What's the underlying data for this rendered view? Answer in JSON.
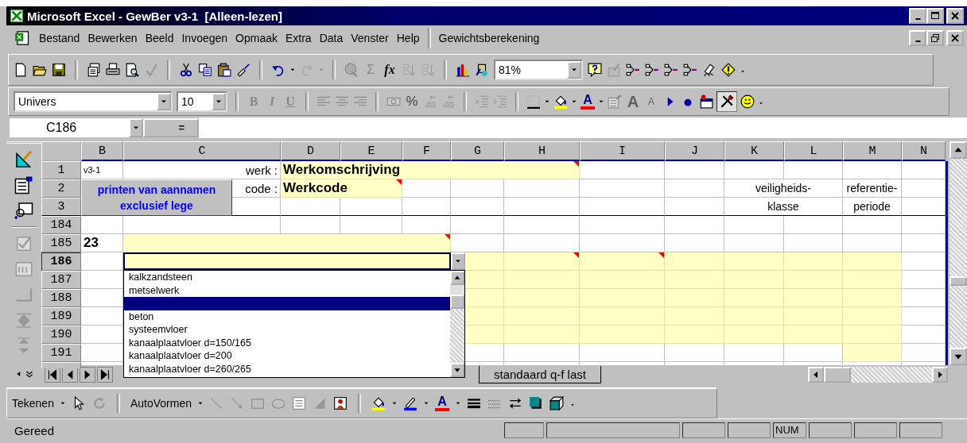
{
  "window": {
    "title": "Microsoft Excel - GewBer v3-1  [Alleen-lezen]"
  },
  "menu": {
    "items": [
      "Bestand",
      "Bewerken",
      "Beeld",
      "Invoegen",
      "Opmaak",
      "Extra",
      "Data",
      "Venster",
      "Help"
    ],
    "custom": "Gewichtsberekening"
  },
  "standard_toolbar": {
    "sum_symbol": "Σ",
    "function_symbol": "fx",
    "zoom": "81%"
  },
  "format_toolbar": {
    "font": "Univers",
    "size": "10",
    "bold": "B",
    "italic": "I",
    "underline": "U",
    "percent": "%",
    "font_color": "A",
    "grow_font": "A",
    "shrink_font": "A"
  },
  "formula_bar": {
    "name_box": "C186",
    "equals": "="
  },
  "sheet": {
    "columns": [
      "B",
      "C",
      "D",
      "E",
      "F",
      "G",
      "H",
      "I",
      "J",
      "K",
      "L",
      "M",
      "N"
    ],
    "button": "printen van aannamen exclusief lege",
    "rows": [
      {
        "number": "1",
        "active": false,
        "rule_below": false,
        "cells": [
          {
            "kind": "note",
            "text": "v3-1"
          },
          {
            "kind": "label",
            "text": "werk :"
          },
          {
            "kind": "value",
            "text": "Werkomschrijving",
            "comment": true
          },
          {
            "kind": "merged"
          },
          {
            "kind": "merged"
          },
          {
            "kind": "merged"
          },
          {
            "kind": "merged"
          },
          {
            "kind": "empty"
          },
          {
            "kind": "empty"
          },
          {
            "kind": "empty"
          },
          {
            "kind": "empty"
          },
          {
            "kind": "empty"
          },
          {
            "kind": "empty"
          }
        ]
      },
      {
        "number": "2",
        "active": false,
        "rule_below": false,
        "cells": [
          {
            "kind": "covered"
          },
          {
            "kind": "label",
            "text": "code :"
          },
          {
            "kind": "value",
            "text": "Werkcode",
            "comment": true
          },
          {
            "kind": "merged"
          },
          {
            "kind": "empty"
          },
          {
            "kind": "empty"
          },
          {
            "kind": "empty"
          },
          {
            "kind": "empty"
          },
          {
            "kind": "empty"
          },
          {
            "kind": "heading",
            "text": "veiligheids-"
          },
          {
            "kind": "merged"
          },
          {
            "kind": "heading",
            "text": "referentie-"
          },
          {
            "kind": "empty"
          }
        ]
      },
      {
        "number": "3",
        "active": false,
        "rule_below": true,
        "cells": [
          {
            "kind": "covered"
          },
          {
            "kind": "empty"
          },
          {
            "kind": "empty"
          },
          {
            "kind": "empty"
          },
          {
            "kind": "empty"
          },
          {
            "kind": "empty"
          },
          {
            "kind": "empty"
          },
          {
            "kind": "empty"
          },
          {
            "kind": "empty"
          },
          {
            "kind": "heading",
            "text": "klasse"
          },
          {
            "kind": "merged"
          },
          {
            "kind": "heading",
            "text": "periode"
          },
          {
            "kind": "empty"
          }
        ]
      },
      {
        "number": "184",
        "active": false,
        "rule_below": false,
        "cells": [
          {
            "kind": "empty"
          },
          {
            "kind": "empty"
          },
          {
            "kind": "empty"
          },
          {
            "kind": "empty"
          },
          {
            "kind": "empty"
          },
          {
            "kind": "empty"
          },
          {
            "kind": "empty"
          },
          {
            "kind": "empty"
          },
          {
            "kind": "empty"
          },
          {
            "kind": "empty"
          },
          {
            "kind": "empty"
          },
          {
            "kind": "empty"
          },
          {
            "kind": "empty"
          }
        ]
      },
      {
        "number": "185",
        "active": false,
        "rule_below": false,
        "cells": [
          {
            "kind": "number",
            "text": "23"
          },
          {
            "kind": "input",
            "comment": true
          },
          {
            "kind": "merged"
          },
          {
            "kind": "merged"
          },
          {
            "kind": "merged"
          },
          {
            "kind": "empty"
          },
          {
            "kind": "empty"
          },
          {
            "kind": "empty"
          },
          {
            "kind": "empty"
          },
          {
            "kind": "empty"
          },
          {
            "kind": "empty"
          },
          {
            "kind": "empty"
          },
          {
            "kind": "empty"
          }
        ]
      },
      {
        "number": "186",
        "active": true,
        "rule_below": false,
        "cells": [
          {
            "kind": "empty"
          },
          {
            "kind": "covered"
          },
          {
            "kind": "covered"
          },
          {
            "kind": "empty"
          },
          {
            "kind": "empty"
          },
          {
            "kind": "input",
            "comment": false
          },
          {
            "kind": "input",
            "comment": true
          },
          {
            "kind": "input",
            "comment": true
          },
          {
            "kind": "input",
            "comment": false
          },
          {
            "kind": "input",
            "comment": false
          },
          {
            "kind": "input",
            "comment": false
          },
          {
            "kind": "input",
            "comment": false
          },
          {
            "kind": "empty"
          }
        ]
      },
      {
        "number": "187",
        "active": false,
        "rule_below": false,
        "cells": [
          {
            "kind": "empty"
          },
          {
            "kind": "empty"
          },
          {
            "kind": "empty"
          },
          {
            "kind": "empty"
          },
          {
            "kind": "empty"
          },
          {
            "kind": "input",
            "comment": false
          },
          {
            "kind": "input",
            "comment": false
          },
          {
            "kind": "input",
            "comment": false
          },
          {
            "kind": "input",
            "comment": false
          },
          {
            "kind": "input",
            "comment": false
          },
          {
            "kind": "input",
            "comment": false
          },
          {
            "kind": "input",
            "comment": false
          },
          {
            "kind": "empty"
          }
        ]
      },
      {
        "number": "188",
        "active": false,
        "rule_below": false,
        "cells": [
          {
            "kind": "empty"
          },
          {
            "kind": "empty"
          },
          {
            "kind": "empty"
          },
          {
            "kind": "empty"
          },
          {
            "kind": "empty"
          },
          {
            "kind": "input",
            "comment": false
          },
          {
            "kind": "input",
            "comment": false
          },
          {
            "kind": "input",
            "comment": false
          },
          {
            "kind": "input",
            "comment": false
          },
          {
            "kind": "input",
            "comment": false
          },
          {
            "kind": "input",
            "comment": false
          },
          {
            "kind": "input",
            "comment": false
          },
          {
            "kind": "empty"
          }
        ]
      },
      {
        "number": "189",
        "active": false,
        "rule_below": false,
        "cells": [
          {
            "kind": "empty"
          },
          {
            "kind": "empty"
          },
          {
            "kind": "empty"
          },
          {
            "kind": "empty"
          },
          {
            "kind": "empty"
          },
          {
            "kind": "input",
            "comment": false
          },
          {
            "kind": "input",
            "comment": false
          },
          {
            "kind": "input",
            "comment": false
          },
          {
            "kind": "input",
            "comment": false
          },
          {
            "kind": "input",
            "comment": false
          },
          {
            "kind": "input",
            "comment": false
          },
          {
            "kind": "input",
            "comment": false
          },
          {
            "kind": "empty"
          }
        ]
      },
      {
        "number": "190",
        "active": false,
        "rule_below": false,
        "cells": [
          {
            "kind": "empty"
          },
          {
            "kind": "empty"
          },
          {
            "kind": "empty"
          },
          {
            "kind": "empty"
          },
          {
            "kind": "empty"
          },
          {
            "kind": "input",
            "comment": false
          },
          {
            "kind": "input",
            "comment": false
          },
          {
            "kind": "input",
            "comment": false
          },
          {
            "kind": "input",
            "comment": false
          },
          {
            "kind": "input",
            "comment": false
          },
          {
            "kind": "input",
            "comment": false
          },
          {
            "kind": "input",
            "comment": false
          },
          {
            "kind": "empty"
          }
        ]
      },
      {
        "number": "191",
        "active": false,
        "rule_below": false,
        "cells": [
          {
            "kind": "empty"
          },
          {
            "kind": "empty"
          },
          {
            "kind": "empty"
          },
          {
            "kind": "empty"
          },
          {
            "kind": "empty"
          },
          {
            "kind": "empty"
          },
          {
            "kind": "empty"
          },
          {
            "kind": "empty"
          },
          {
            "kind": "empty"
          },
          {
            "kind": "empty"
          },
          {
            "kind": "empty"
          },
          {
            "kind": "input",
            "comment": false
          },
          {
            "kind": "empty"
          }
        ]
      }
    ]
  },
  "dropdown": {
    "items": [
      {
        "label": "kalkzandsteen",
        "selected": false
      },
      {
        "label": "metselwerk",
        "selected": false
      },
      {
        "selected": true
      },
      {
        "label": "beton",
        "selected": false
      },
      {
        "label": "systeemvloer",
        "selected": false
      },
      {
        "label": "kanaalplaatvloer d=150/165",
        "selected": false
      },
      {
        "label": "kanaalplaatvloer d=200",
        "selected": false
      },
      {
        "label": "kanaalplaatvloer d=260/265",
        "selected": false
      }
    ]
  },
  "sheet_tabs": [
    {
      "label": "standaard q-f last",
      "selected": false
    }
  ],
  "drawing_toolbar": {
    "draw": "Tekenen",
    "autoshapes": "AutoVormen",
    "font_color": "A"
  },
  "status_bar": {
    "message": "Gereed",
    "indicators": [
      "NUM"
    ]
  }
}
